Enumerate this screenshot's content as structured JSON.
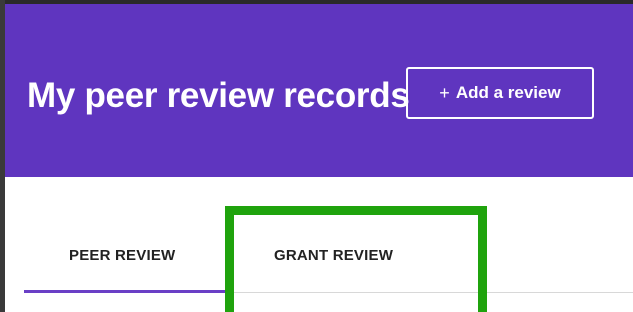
{
  "header": {
    "title": "My peer review records",
    "add_button": {
      "icon": "+",
      "label": "Add a review"
    }
  },
  "tabs": [
    {
      "label": "PEER REVIEW",
      "selected": true
    },
    {
      "label": "GRANT REVIEW",
      "selected": false
    }
  ],
  "colors": {
    "header_background": "#5f35bf",
    "active_tab_underline": "#6a3fc6",
    "highlight_border": "#1fa30d"
  }
}
